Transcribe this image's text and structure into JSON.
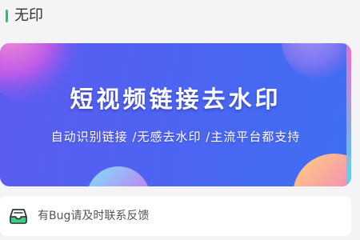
{
  "section": {
    "title": "无印",
    "accent_color": "#1fc46b"
  },
  "banner": {
    "title": "短视频链接去水印",
    "subtitle": "自动识别链接 /无感去水印 /主流平台都支持",
    "background_color": "#4e63f2"
  },
  "feedback": {
    "icon": "inbox-tray-icon",
    "label": "有Bug请及时联系反馈"
  }
}
